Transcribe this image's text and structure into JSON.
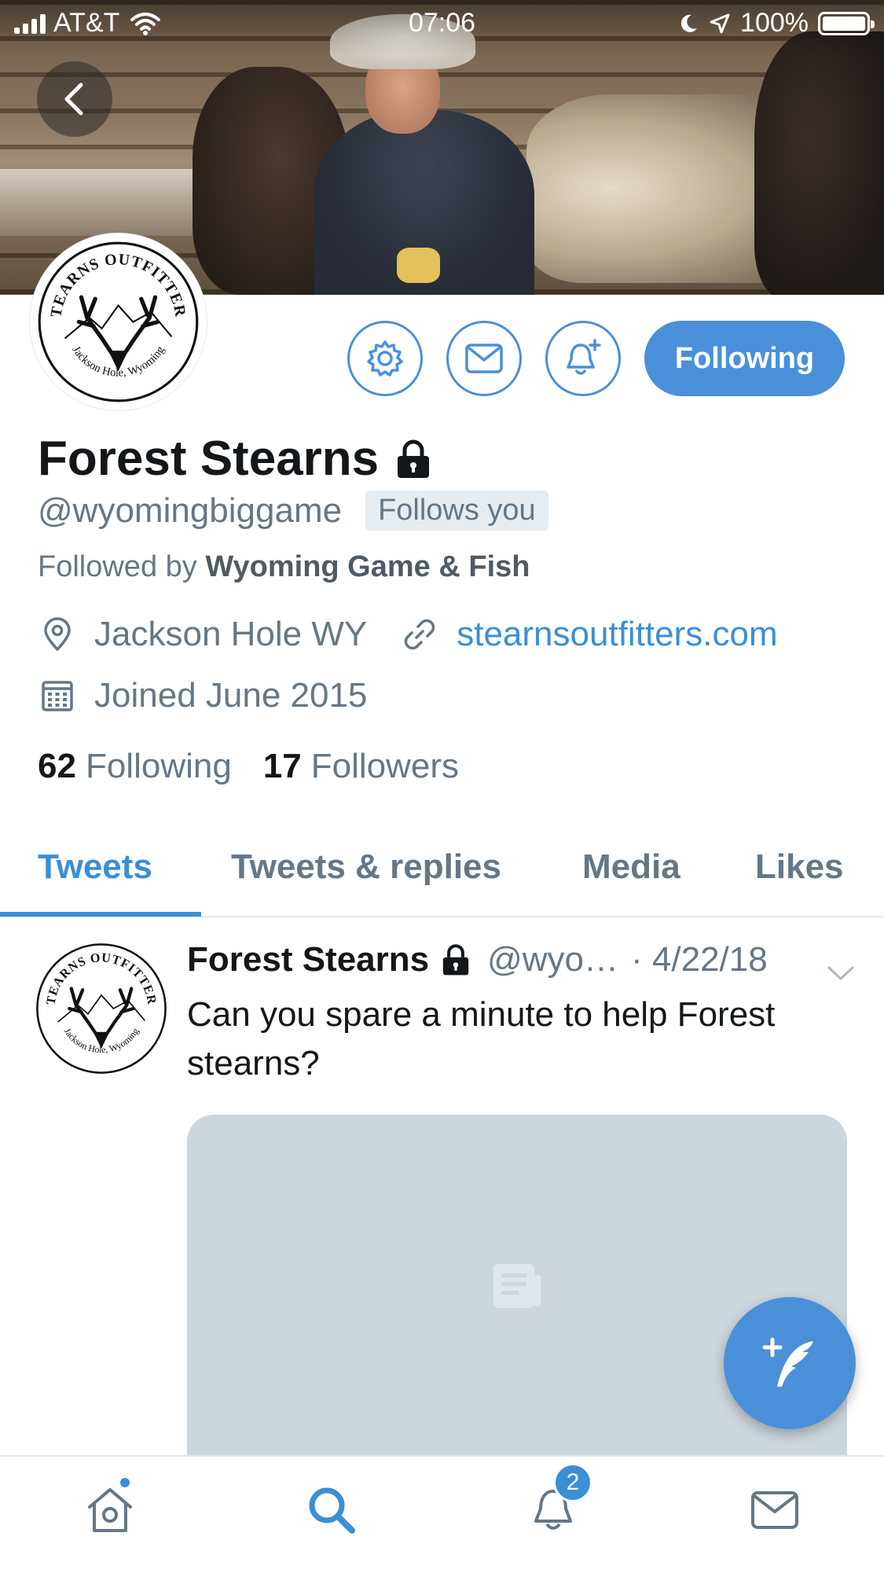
{
  "status_bar": {
    "carrier": "AT&T",
    "time": "07:06",
    "battery": "100%"
  },
  "profile": {
    "display_name": "Forest Stearns",
    "handle": "@wyomingbiggame",
    "follows_you_label": "Follows you",
    "followed_by_prefix": "Followed by",
    "followed_by_name": "Wyoming Game & Fish",
    "location": "Jackson Hole WY",
    "website": "stearnsoutfitters.com",
    "joined": "Joined June 2015",
    "following_count": "62",
    "following_label": "Following",
    "followers_count": "17",
    "followers_label": "Followers",
    "avatar_text_top": "STEARNS OUTFITTERS",
    "avatar_text_bottom": "Jackson Hole, Wyoming"
  },
  "actions": {
    "following_button": "Following"
  },
  "tabs": [
    {
      "label": "Tweets",
      "active": true
    },
    {
      "label": "Tweets & replies",
      "active": false
    },
    {
      "label": "Media",
      "active": false
    },
    {
      "label": "Likes",
      "active": false
    }
  ],
  "tweet": {
    "name": "Forest Stearns",
    "handle": "@wyo…",
    "date": "· 4/22/18",
    "text": "Can you spare a minute to help Forest stearns?"
  },
  "bottom_nav": {
    "notifications_badge": "2"
  },
  "colors": {
    "accent": "#4a90d9",
    "link": "#3a8fd6",
    "secondary_text": "#657786",
    "card_placeholder": "#ccd6dd"
  },
  "icons": {
    "back": "chevron-left-icon",
    "settings": "gear-icon",
    "message": "envelope-icon",
    "notify": "bell-plus-icon",
    "lock": "lock-icon",
    "location": "map-pin-icon",
    "link": "link-icon",
    "calendar": "calendar-icon",
    "caret": "chevron-down-icon",
    "compose": "quill-plus-icon",
    "home": "home-icon",
    "search": "search-icon",
    "notifications": "bell-icon",
    "messages": "envelope-icon"
  }
}
